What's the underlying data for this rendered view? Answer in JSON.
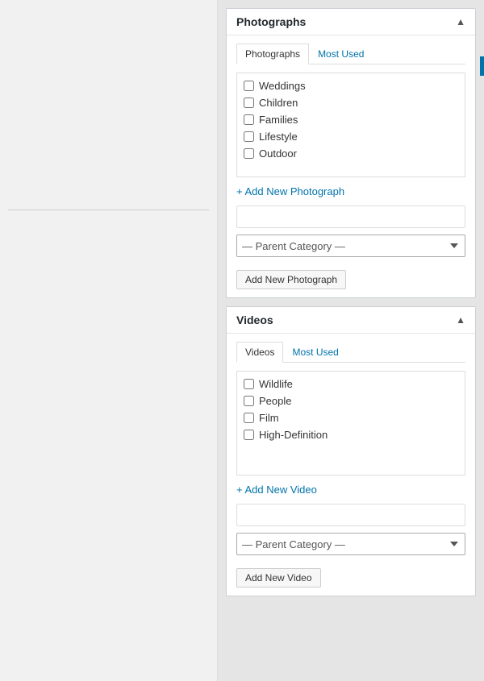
{
  "leftPanel": {
    "visible": true
  },
  "photographs": {
    "title": "Photographs",
    "tabs": [
      {
        "label": "Photographs",
        "active": true
      },
      {
        "label": "Most Used",
        "active": false
      }
    ],
    "categories": [
      {
        "label": "Weddings",
        "checked": false
      },
      {
        "label": "Children",
        "checked": false
      },
      {
        "label": "Families",
        "checked": false
      },
      {
        "label": "Lifestyle",
        "checked": false
      },
      {
        "label": "Outdoor",
        "checked": false
      }
    ],
    "addNewLink": "+ Add New Photograph",
    "inputPlaceholder": "",
    "parentCategoryLabel": "— Parent Category —",
    "addButtonLabel": "Add New Photograph"
  },
  "videos": {
    "title": "Videos",
    "tabs": [
      {
        "label": "Videos",
        "active": true
      },
      {
        "label": "Most Used",
        "active": false
      }
    ],
    "categories": [
      {
        "label": "Wildlife",
        "checked": false
      },
      {
        "label": "People",
        "checked": false
      },
      {
        "label": "Film",
        "checked": false
      },
      {
        "label": "High-Definition",
        "checked": false
      }
    ],
    "addNewLink": "+ Add New Video",
    "inputPlaceholder": "",
    "parentCategoryLabel": "— Parent Category —",
    "addButtonLabel": "Add New Video"
  },
  "icons": {
    "collapseArrow": "▲"
  }
}
